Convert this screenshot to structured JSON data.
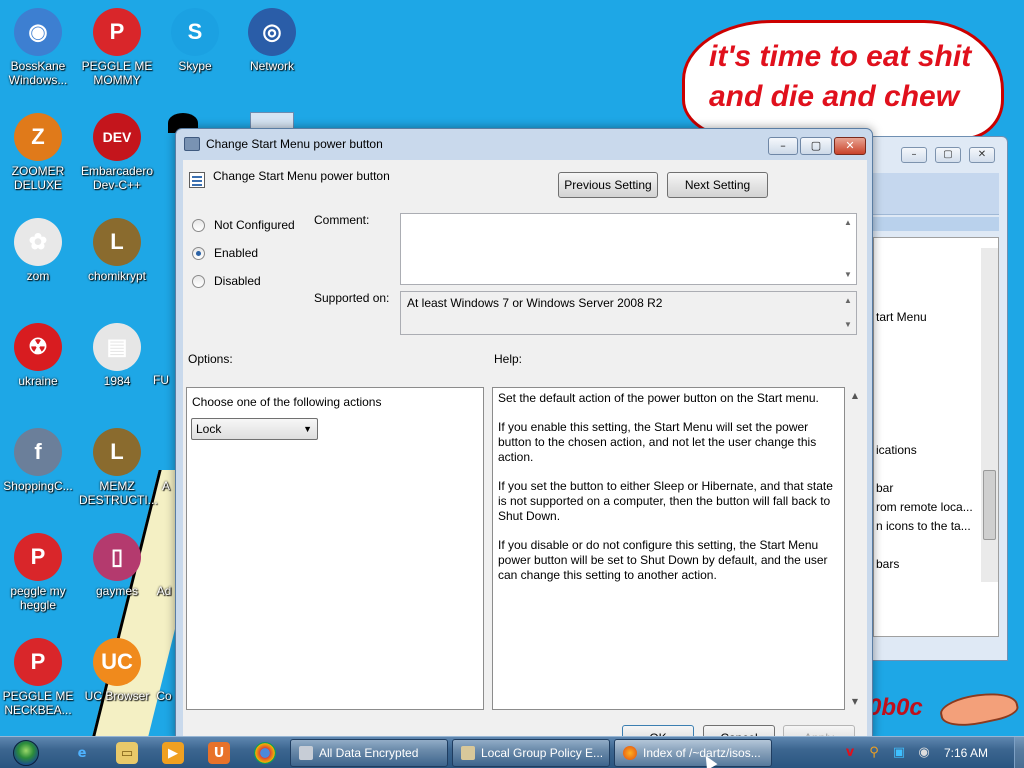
{
  "wallpaper": {
    "bubble_text": "it's time to eat shit and die and chew",
    "corner_text": "0b0c"
  },
  "desktop_icons": [
    {
      "label": "BossKane Windows...",
      "color": "#3d7fd1",
      "glyph": "◉",
      "name": "bosskane-windows-icon"
    },
    {
      "label": "PEGGLE ME MOMMY",
      "color": "#d9262a",
      "glyph": "P",
      "name": "peggle-me-mommy-icon"
    },
    {
      "label": "Skype",
      "color": "#1ba1e2",
      "glyph": "S",
      "name": "skype-icon"
    },
    {
      "label": "Network",
      "color": "#2a5da8",
      "glyph": "◎",
      "name": "network-icon"
    },
    {
      "label": "ZOOMER DELUXE",
      "color": "#e07a1a",
      "glyph": "Z",
      "name": "zoomer-deluxe-icon"
    },
    {
      "label": "Embarcadero Dev-C++",
      "color": "#c4151c",
      "glyph": "DEV",
      "name": "dev-cpp-icon"
    },
    {
      "label": "zom",
      "color": "#e8e8e8",
      "glyph": "✿",
      "name": "zom-icon"
    },
    {
      "label": "chomikrypt",
      "color": "#8a6b2e",
      "glyph": "L",
      "name": "chomikrypt-icon"
    },
    {
      "label": "ukraine",
      "color": "#d81c20",
      "glyph": "☢",
      "name": "ukraine-icon"
    },
    {
      "label": "1984",
      "color": "#e6e6e6",
      "glyph": "▤",
      "name": "file-1984-icon"
    },
    {
      "label": "ShoppingC...",
      "color": "#6b7f9a",
      "glyph": "f",
      "name": "shopping-icon"
    },
    {
      "label": "MEMZ DESTRUCTI...",
      "color": "#8a6b2e",
      "glyph": "L",
      "name": "memz-icon"
    },
    {
      "label": "peggle my heggle",
      "color": "#d9262a",
      "glyph": "P",
      "name": "peggle-my-heggle-icon"
    },
    {
      "label": "gaymes",
      "color": "#b43a6e",
      "glyph": "▯",
      "name": "gaymes-icon"
    },
    {
      "label": "PEGGLE ME NECKBEA...",
      "color": "#d9262a",
      "glyph": "P",
      "name": "peggle-me-neckbeard-icon"
    },
    {
      "label": "UC Browser",
      "color": "#f08a1c",
      "glyph": "UC",
      "name": "uc-browser-icon"
    }
  ],
  "partial_labels": {
    "fu": "FU",
    "ac": "A",
    "ad": "Ad",
    "co": "Co"
  },
  "bg_window": {
    "rows": [
      "tart Menu",
      "ications",
      "bar",
      "rom remote loca...",
      "n icons to the ta...",
      "bars"
    ]
  },
  "dialog": {
    "window_title": "Change Start Menu power button",
    "header_title": "Change Start Menu power button",
    "previous_setting": "Previous Setting",
    "next_setting": "Next Setting",
    "radios": {
      "not_configured": "Not Configured",
      "enabled": "Enabled",
      "disabled": "Disabled",
      "selected": "Enabled"
    },
    "comment_label": "Comment:",
    "comment_value": "",
    "supported_label": "Supported on:",
    "supported_value": "At least Windows 7 or Windows Server 2008 R2",
    "options_label": "Options:",
    "help_label": "Help:",
    "options_prompt": "Choose one of the following actions",
    "action_selected": "Lock",
    "help_paragraphs": [
      "Set the default action of the power button on the Start menu.",
      "If you enable this setting, the Start Menu will set the power button to the chosen action, and not let the user change this action.",
      "If you set the button to either Sleep or Hibernate, and that state is not supported on a computer, then the button will fall back to Shut Down.",
      "If you disable or do not configure this setting, the Start Menu power button will be set to Shut Down by default, and the user can change this setting to another action."
    ],
    "ok": "OK",
    "cancel": "Cancel",
    "apply": "Apply"
  },
  "taskbar": {
    "tasks": [
      {
        "label": "All Data Encrypted",
        "active": false
      },
      {
        "label": "Local Group Policy E...",
        "active": false
      },
      {
        "label": "Index of /~dartz/isos...",
        "active": true
      }
    ],
    "clock": "7:16 AM"
  },
  "colors": {
    "desktop": "#1ea7e6",
    "dialog_frame": "#c9d9ec",
    "dialog_body": "#f0f0f0",
    "taskbar": "#3c6690",
    "bubble_text": "#e0101c"
  }
}
